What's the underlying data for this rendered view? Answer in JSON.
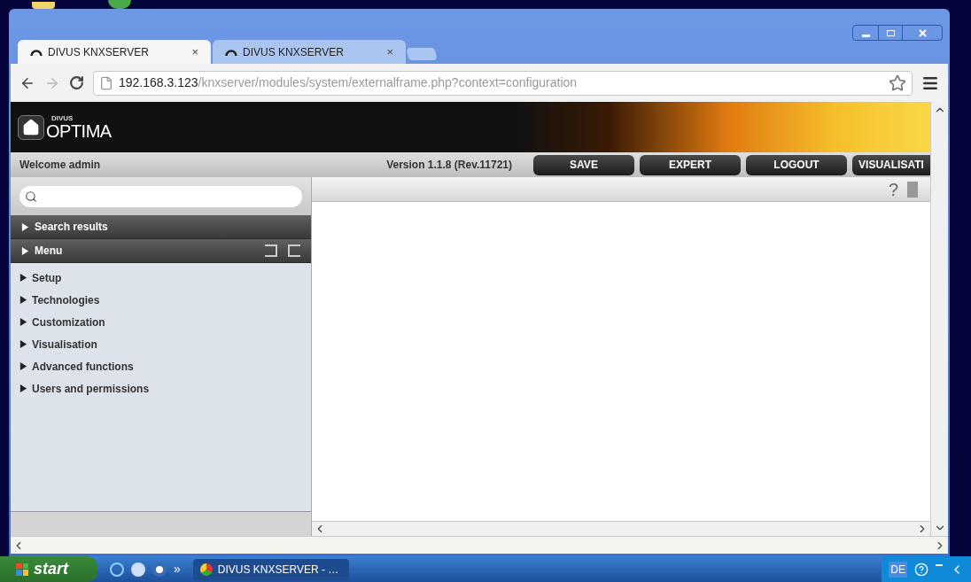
{
  "tabs": [
    {
      "label": "DIVUS KNXSERVER",
      "selected": true
    },
    {
      "label": "DIVUS KNXSERVER",
      "selected": false
    }
  ],
  "tab_close": "×",
  "address_bar": {
    "host": "192.168.3.123",
    "path": "/knxserver/modules/system/externalframe.php?context=configuration"
  },
  "header": {
    "brand_small": "DIVUS",
    "brand_large": "OPTIMA"
  },
  "toolbar": {
    "welcome": "Welcome admin",
    "version": "Version 1.1.8 (Rev.11721)",
    "buttons": [
      "SAVE",
      "EXPERT",
      "LOGOUT",
      "VISUALISATI"
    ]
  },
  "sidebar": {
    "sections": [
      {
        "label": "Search results",
        "expanded": false
      },
      {
        "label": "Menu",
        "expanded": false
      }
    ],
    "items": [
      {
        "label": "Setup",
        "expanded": false
      },
      {
        "label": "Technologies",
        "expanded": false
      },
      {
        "label": "Customization",
        "expanded": false
      },
      {
        "label": "Visualisation",
        "expanded": false
      },
      {
        "label": "Advanced functions",
        "expanded": false
      },
      {
        "label": "Users and permissions",
        "expanded": false
      }
    ]
  },
  "content_toolbar": {
    "help": "?"
  },
  "taskbar": {
    "start": "start",
    "overflow": "»",
    "task": "DIVUS KNXSERVER - …",
    "language": "DE"
  }
}
